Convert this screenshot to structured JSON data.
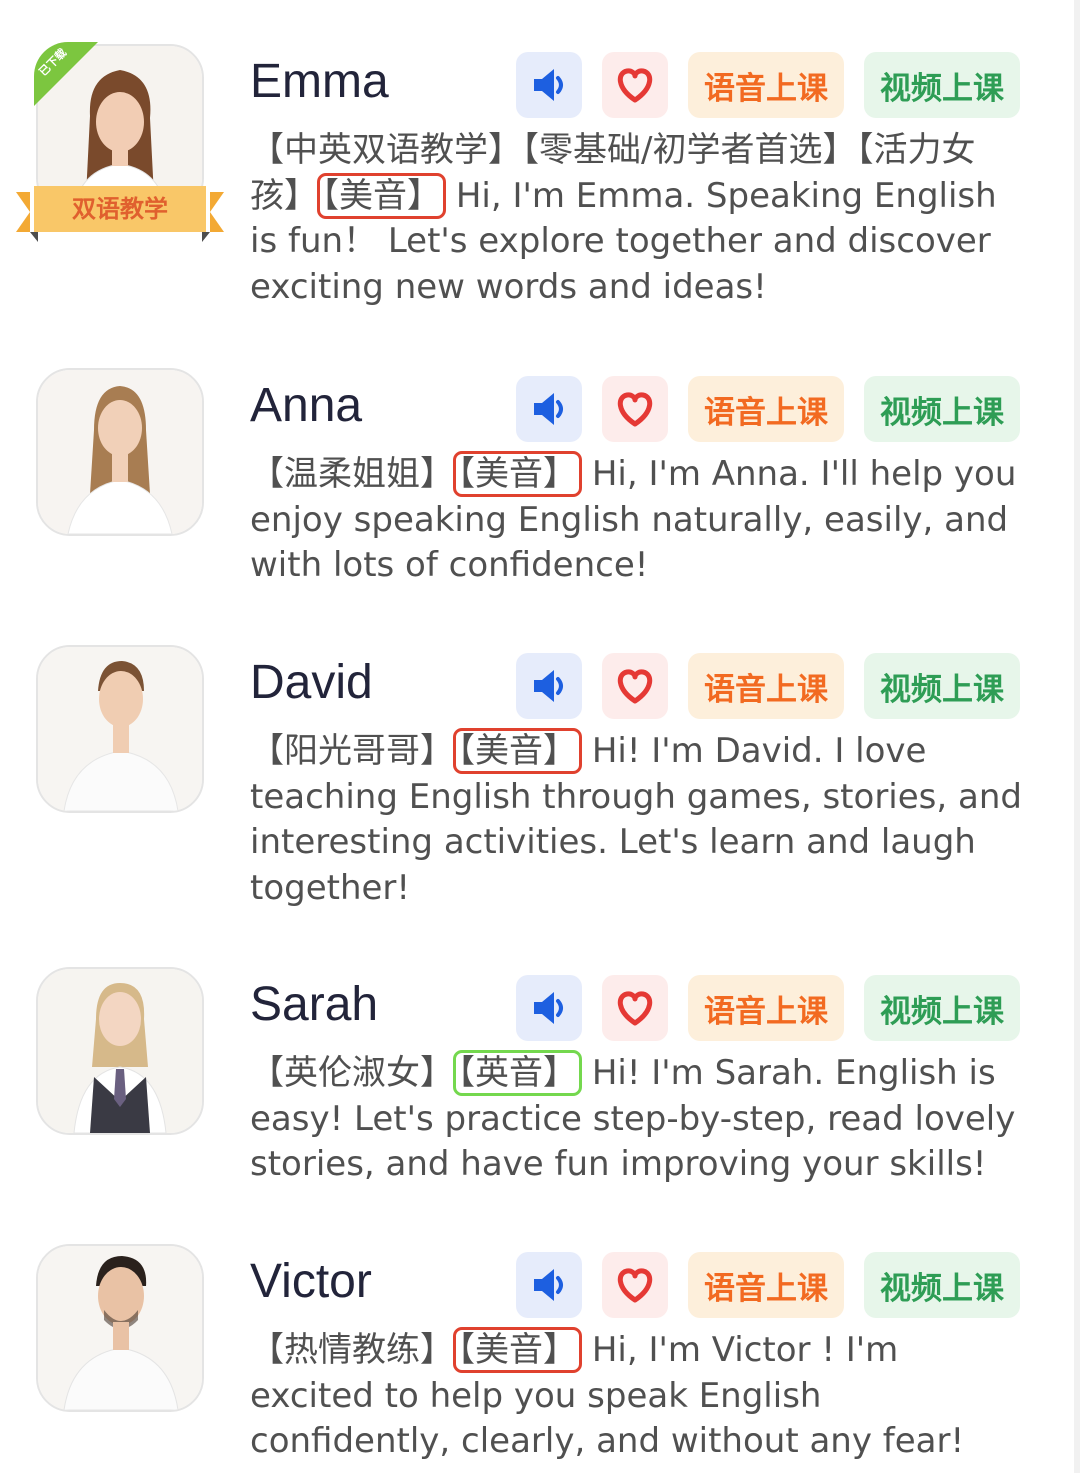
{
  "colors": {
    "speaker_icon": "#1d5fe0",
    "heart_icon": "#e53935",
    "voice_class": "#f26a21",
    "video_class": "#2e9d55",
    "accent_us_box": "#e0412e",
    "accent_uk_box": "#74d84e"
  },
  "buttons": {
    "speaker_icon": "speaker-icon",
    "heart_icon": "heart-icon",
    "voice_class_label": "语音上课",
    "video_class_label": "视频上课"
  },
  "teachers": [
    {
      "name": "Emma",
      "downloaded_badge": "已下载",
      "ribbon": "双语教学",
      "tags_before": "【中英双语教学】【零基础/初学者首选】【活力女孩】",
      "accent_tag": "【美音】",
      "intro": "Hi, I'm Emma. Speaking English is fun！ Let's explore together and discover exciting new words and ideas!"
    },
    {
      "name": "Anna",
      "tags_before": "【温柔姐姐】",
      "accent_tag": "【美音】",
      "intro": "Hi, I'm Anna. I'll help you enjoy speaking English naturally, easily, and with lots of confidence!"
    },
    {
      "name": "David",
      "tags_before": "【阳光哥哥】",
      "accent_tag": "【美音】",
      "intro": "Hi! I'm David. I love teaching English through games, stories, and interesting activities. Let's learn and laugh together!"
    },
    {
      "name": "Sarah",
      "tags_before": "【英伦淑女】",
      "accent_tag": "【英音】",
      "intro": "Hi! I'm Sarah. English is easy! Let's practice step-by-step, read lovely stories, and have fun improving your skills!"
    },
    {
      "name": "Victor",
      "tags_before": "【热情教练】",
      "accent_tag": "【美音】",
      "intro": "Hi, I'm Victor ! I'm excited to help you speak English confidently, clearly, and without any fear!"
    }
  ]
}
